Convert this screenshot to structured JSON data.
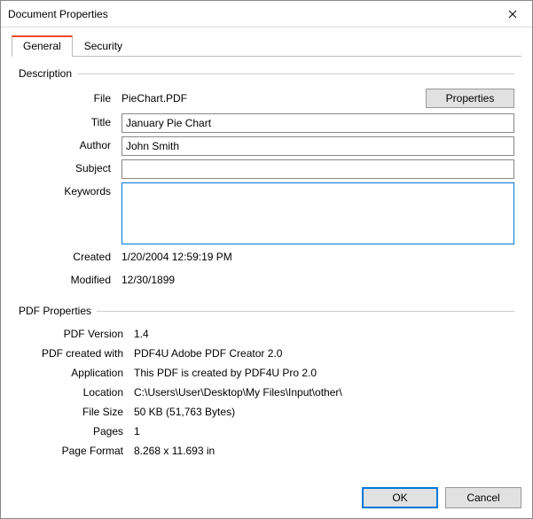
{
  "window": {
    "title": "Document Properties"
  },
  "tabs": {
    "general": "General",
    "security": "Security"
  },
  "groups": {
    "description": "Description",
    "pdfprops": "PDF Properties"
  },
  "labels": {
    "file": "File",
    "title": "Title",
    "author": "Author",
    "subject": "Subject",
    "keywords": "Keywords",
    "created": "Created",
    "modified": "Modified",
    "pdfversion": "PDF Version",
    "pdfcreatedwith": "PDF created with",
    "application": "Application",
    "location": "Location",
    "filesize": "File Size",
    "pages": "Pages",
    "pageformat": "Page Format"
  },
  "buttons": {
    "properties": "Properties",
    "ok": "OK",
    "cancel": "Cancel"
  },
  "values": {
    "file": "PieChart.PDF",
    "title": "January Pie Chart",
    "author": "John Smith",
    "subject": "",
    "keywords": "",
    "created": "1/20/2004 12:59:19 PM",
    "modified": "12/30/1899",
    "pdfversion": "1.4",
    "pdfcreatedwith": "PDF4U Adobe PDF Creator 2.0",
    "application": "This PDF is created by PDF4U Pro 2.0",
    "location": "C:\\Users\\User\\Desktop\\My Files\\Input\\other\\",
    "filesize": "50 KB (51,763 Bytes)",
    "pages": "1",
    "pageformat": "8.268 x 11.693 in"
  }
}
